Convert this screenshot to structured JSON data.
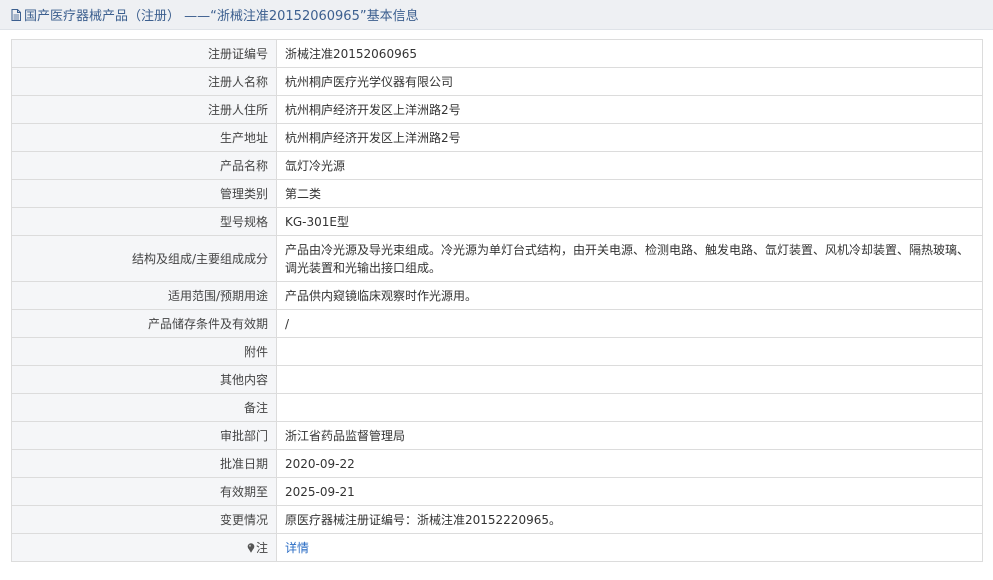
{
  "header": {
    "title": "国产医疗器械产品（注册） ——“浙械注准20152060965”基本信息"
  },
  "rows": [
    {
      "label": "注册证编号",
      "value": "浙械注准20152060965"
    },
    {
      "label": "注册人名称",
      "value": "杭州桐庐医疗光学仪器有限公司"
    },
    {
      "label": "注册人住所",
      "value": "杭州桐庐经济开发区上洋洲路2号"
    },
    {
      "label": "生产地址",
      "value": "杭州桐庐经济开发区上洋洲路2号"
    },
    {
      "label": "产品名称",
      "value": "氙灯冷光源"
    },
    {
      "label": "管理类别",
      "value": "第二类"
    },
    {
      "label": "型号规格",
      "value": "KG-301E型"
    },
    {
      "label": "结构及组成/主要组成成分",
      "value": "产品由冷光源及导光束组成。冷光源为单灯台式结构，由开关电源、检测电路、触发电路、氙灯装置、风机冷却装置、隔热玻璃、调光装置和光输出接口组成。"
    },
    {
      "label": "适用范围/预期用途",
      "value": "产品供内窥镜临床观察时作光源用。"
    },
    {
      "label": "产品储存条件及有效期",
      "value": "/"
    },
    {
      "label": "附件",
      "value": ""
    },
    {
      "label": "其他内容",
      "value": ""
    },
    {
      "label": "备注",
      "value": ""
    },
    {
      "label": "审批部门",
      "value": "浙江省药品监督管理局"
    },
    {
      "label": "批准日期",
      "value": "2020-09-22"
    },
    {
      "label": "有效期至",
      "value": "2025-09-21"
    },
    {
      "label": "变更情况",
      "value": "原医疗器械注册证编号：浙械注准20152220965。"
    }
  ],
  "note_row": {
    "label": "注",
    "link_text": "详情"
  },
  "colors": {
    "header_text": "#3c5f8f",
    "link": "#2a6cc4",
    "label_bg": "#f5f6f8"
  }
}
